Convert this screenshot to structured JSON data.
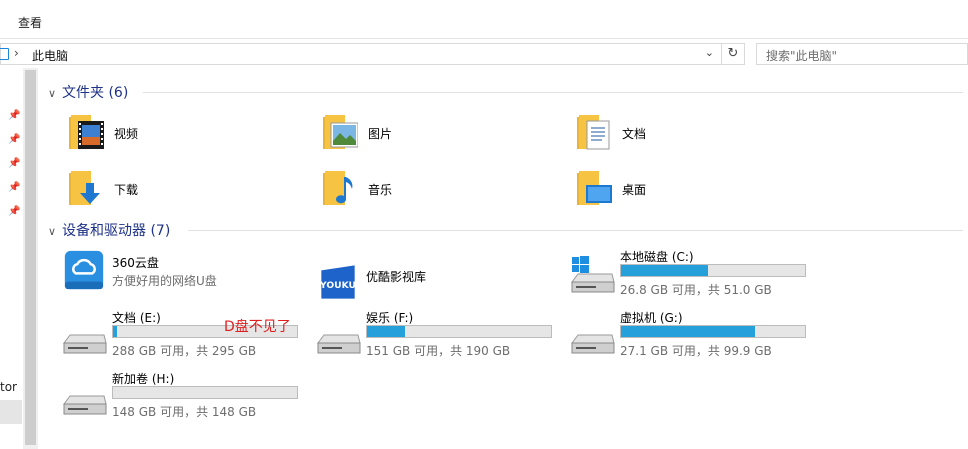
{
  "ribbon": {
    "tab_view": "查看"
  },
  "address": {
    "crumb": "此电脑",
    "dropdown": "⌄",
    "refresh": "↻"
  },
  "search": {
    "placeholder": "搜索\"此电脑\""
  },
  "nav": {
    "partial_label": "tor"
  },
  "groups": {
    "folders": "文件夹 (6)",
    "devices": "设备和驱动器 (7)"
  },
  "folders": [
    {
      "name": "视频",
      "icon": "video-folder-icon"
    },
    {
      "name": "图片",
      "icon": "pictures-folder-icon"
    },
    {
      "name": "文档",
      "icon": "documents-folder-icon"
    },
    {
      "name": "下载",
      "icon": "downloads-folder-icon"
    },
    {
      "name": "音乐",
      "icon": "music-folder-icon"
    },
    {
      "name": "桌面",
      "icon": "desktop-folder-icon"
    }
  ],
  "drives": [
    {
      "name": "360云盘",
      "sub": "方便好用的网络U盘",
      "icon": "360-cloud-icon",
      "type": "cloud"
    },
    {
      "name": "优酷影视库",
      "sub": "",
      "icon": "youku-icon",
      "type": "app",
      "logo_text": "YOUKU"
    },
    {
      "name": "本地磁盘 (C:)",
      "info": "26.8 GB 可用，共 51.0 GB",
      "used_fraction": 0.475,
      "icon": "windows-drive-icon",
      "type": "disk"
    },
    {
      "name": "文档 (E:)",
      "info": "288 GB 可用，共 295 GB",
      "used_fraction": 0.024,
      "icon": "hard-drive-icon",
      "type": "disk"
    },
    {
      "name": "娱乐 (F:)",
      "info": "151 GB 可用，共 190 GB",
      "used_fraction": 0.205,
      "icon": "hard-drive-icon",
      "type": "disk"
    },
    {
      "name": "虚拟机 (G:)",
      "info": "27.1 GB 可用，共 99.9 GB",
      "used_fraction": 0.729,
      "icon": "hard-drive-icon",
      "type": "disk"
    },
    {
      "name": "新加卷 (H:)",
      "info": "148 GB 可用，共 148 GB",
      "used_fraction": 0.0,
      "icon": "hard-drive-icon",
      "type": "disk"
    }
  ],
  "annotation": "D盘不见了",
  "colors": {
    "bar_fill": "#26a0da",
    "group_header": "#1e3287",
    "folder_yellow": "#f6c342",
    "annotation": "#e02020"
  }
}
